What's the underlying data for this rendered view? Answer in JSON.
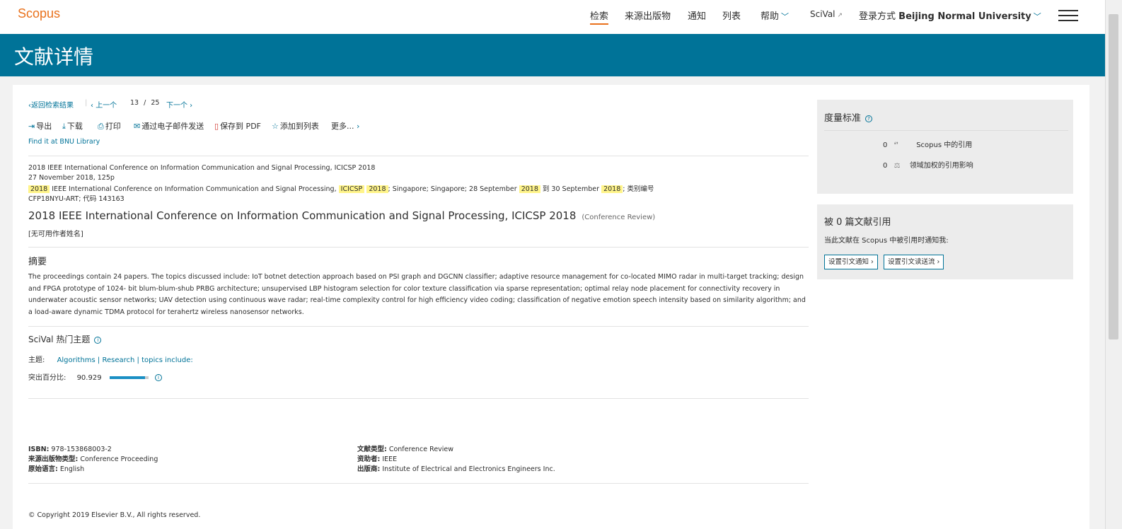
{
  "header": {
    "logo": "Scopus",
    "nav": {
      "search": "检索",
      "sources": "来源出版物",
      "alerts": "通知",
      "lists": "列表",
      "help": "帮助",
      "scival": "SciVal",
      "login_prefix": "登录方式",
      "institution": "Beijing Normal University"
    }
  },
  "page_title": "文献详情",
  "result_nav": {
    "back": "返回检索结果",
    "prev": "上一个",
    "current": "13",
    "separator": "/",
    "total": "25",
    "next": "下一个"
  },
  "toolbar": {
    "export": "导出",
    "download": "下载",
    "print": "打印",
    "email": "通过电子邮件发送",
    "save_pdf": "保存到 PDF",
    "add_list": "添加到列表",
    "more": "更多..."
  },
  "find_it": "Find it at BNU Library",
  "source_info": {
    "line1": "2018 IEEE International Conference on Information Communication and Signal Processing, ICICSP 2018",
    "line2": "27 November 2018, 125p",
    "line3": {
      "year1": "2018",
      "text1": "IEEE International Conference on Information Communication and Signal Processing,",
      "acr": "ICICSP",
      "year2": "2018",
      "text2": "; Singapore; Singapore; 28 September",
      "year3": "2018",
      "text3": "到 30 September",
      "year4": "2018",
      "text4": "; 类别编号"
    },
    "line4": "CFP18NYU-ART; 代码 143163"
  },
  "doc_title": "2018 IEEE International Conference on Information Communication and Signal Processing, ICICSP 2018",
  "doc_type": "(Conference Review)",
  "no_author": "[无可用作者姓名]",
  "abstract": {
    "heading": "摘要",
    "text": "The proceedings contain 24 papers. The topics discussed include: IoT botnet detection approach based on PSI graph and DGCNN classifier; adaptive resource management for co-located MIMO radar in multi-target tracking; design and FPGA prototype of 1024- bit blum-blum-shub PRBG architecture; unsupervised LBP histogram selection for color texture classification via sparse representation; optimal relay node placement for connectivity recovery in underwater acoustic sensor networks; UAV detection using continuous wave radar; real-time complexity control for high efficiency video coding; classification of negative emotion speech intensity based on similarity algorithm; and a load-aware dynamic TDMA protocol for terahertz wireless nanosensor networks."
  },
  "scival": {
    "heading": "SciVal 热门主题",
    "topic_label": "主题:",
    "topics": "Algorithms | Research | topics include:",
    "prominence_label": "突出百分比:",
    "prominence_value": "90.929",
    "prominence_fraction": 0.909
  },
  "details": {
    "isbn_label": "ISBN:",
    "isbn": "978-153868003-2",
    "source_type_label": "来源出版物类型:",
    "source_type": "Conference Proceeding",
    "language_label": "原始语言:",
    "language": "English",
    "doc_type_label": "文献类型:",
    "doc_type": "Conference Review",
    "sponsor_label": "资助者:",
    "sponsor": "IEEE",
    "publisher_label": "出版商:",
    "publisher": "Institute of Electrical and Electronics Engineers Inc."
  },
  "copyright": "© Copyright 2019 Elsevier B.V., All rights reserved.",
  "metrics": {
    "heading": "度量标准",
    "scopus_count": "0",
    "scopus_label": "Scopus 中的引用",
    "fwci_count": "0",
    "fwci_label": "领域加权的引用影响"
  },
  "cited_by": {
    "heading": "被 0 篇文献引用",
    "notify": "当此文献在 Scopus 中被引用时通知我:",
    "btn_alert": "设置引文通知",
    "btn_feed": "设置引文读送流"
  },
  "colors": {
    "brand_orange": "#e9711c",
    "header_band": "#007398",
    "highlight": "#fff48a"
  }
}
